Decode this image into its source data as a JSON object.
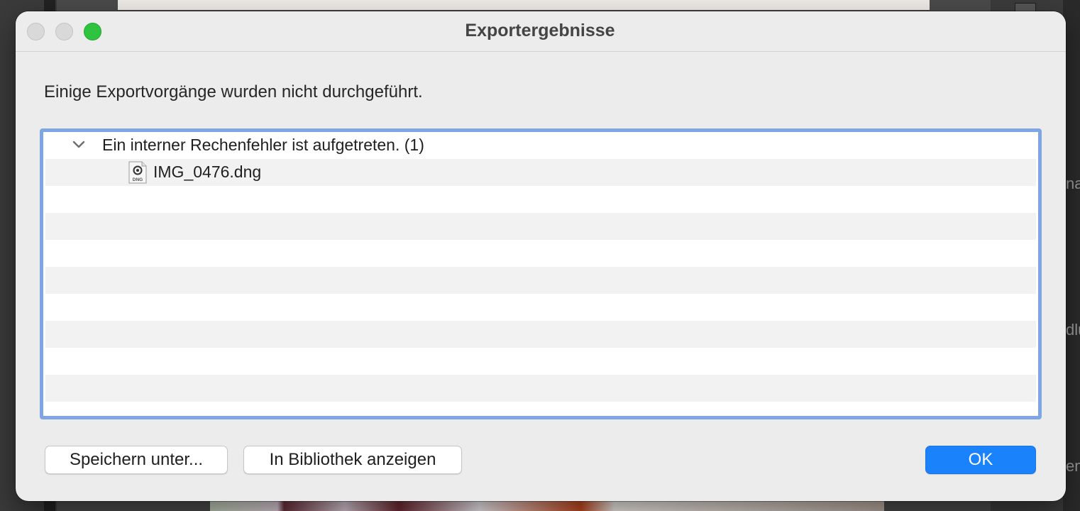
{
  "dialog": {
    "title": "Exportergebnisse",
    "message": "Einige Exportvorgänge wurden nicht durchgeführt.",
    "results": {
      "group_label": "Ein interner Rechenfehler ist aufgetreten. (1)",
      "group_expanded": true,
      "files": [
        {
          "name": "IMG_0476.dng",
          "icon": "dng-file-icon",
          "icon_badge": "DNG"
        }
      ]
    },
    "buttons": {
      "save_as": "Speichern unter...",
      "show_in_library": "In Bibliothek anzeigen",
      "ok": "OK"
    }
  },
  "colors": {
    "accent": "#1a82fb",
    "focus_ring": "#7ea6e4",
    "zoom_button": "#2ec43f"
  },
  "background_app": {
    "right_panel_fragments": [
      "na",
      "dlu",
      "em"
    ]
  }
}
